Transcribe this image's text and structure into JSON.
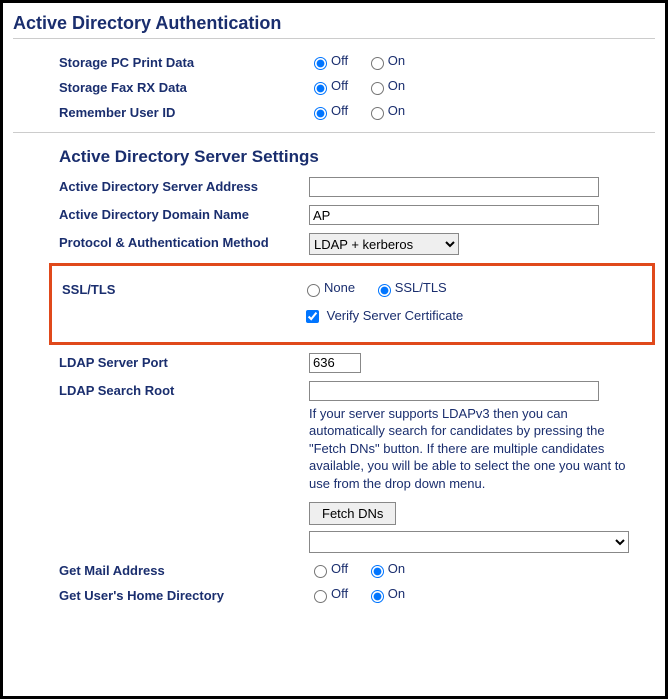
{
  "page": {
    "title": "Active Directory Authentication"
  },
  "common": {
    "off": "Off",
    "on": "On"
  },
  "top": {
    "storagePcPrint": {
      "label": "Storage PC Print Data",
      "value": "Off"
    },
    "storageFaxRx": {
      "label": "Storage Fax RX Data",
      "value": "Off"
    },
    "rememberUserId": {
      "label": "Remember User ID",
      "value": "Off"
    }
  },
  "server": {
    "title": "Active Directory Server Settings",
    "address": {
      "label": "Active Directory Server Address",
      "value": ""
    },
    "domain": {
      "label": "Active Directory Domain Name",
      "value": "AP"
    },
    "protocol": {
      "label": "Protocol & Authentication Method",
      "selected": "LDAP + kerberos"
    },
    "ssltls": {
      "label": "SSL/TLS",
      "optNone": "None",
      "optSslTls": "SSL/TLS",
      "selected": "SSL/TLS",
      "verifyLabel": "Verify Server Certificate",
      "verifyChecked": true
    },
    "ldapPort": {
      "label": "LDAP Server Port",
      "value": "636"
    },
    "ldapSearchRoot": {
      "label": "LDAP Search Root",
      "value": "",
      "help": "If your server supports LDAPv3 then you can automatically search for candidates by pressing the \"Fetch DNs\" button. If there are multiple candidates available, you will be able to select the one you want to use from the drop down menu.",
      "fetchBtn": "Fetch DNs",
      "dnSelected": ""
    },
    "getMail": {
      "label": "Get Mail Address",
      "value": "On"
    },
    "getHomeDir": {
      "label": "Get User's Home Directory",
      "value": "On"
    }
  }
}
